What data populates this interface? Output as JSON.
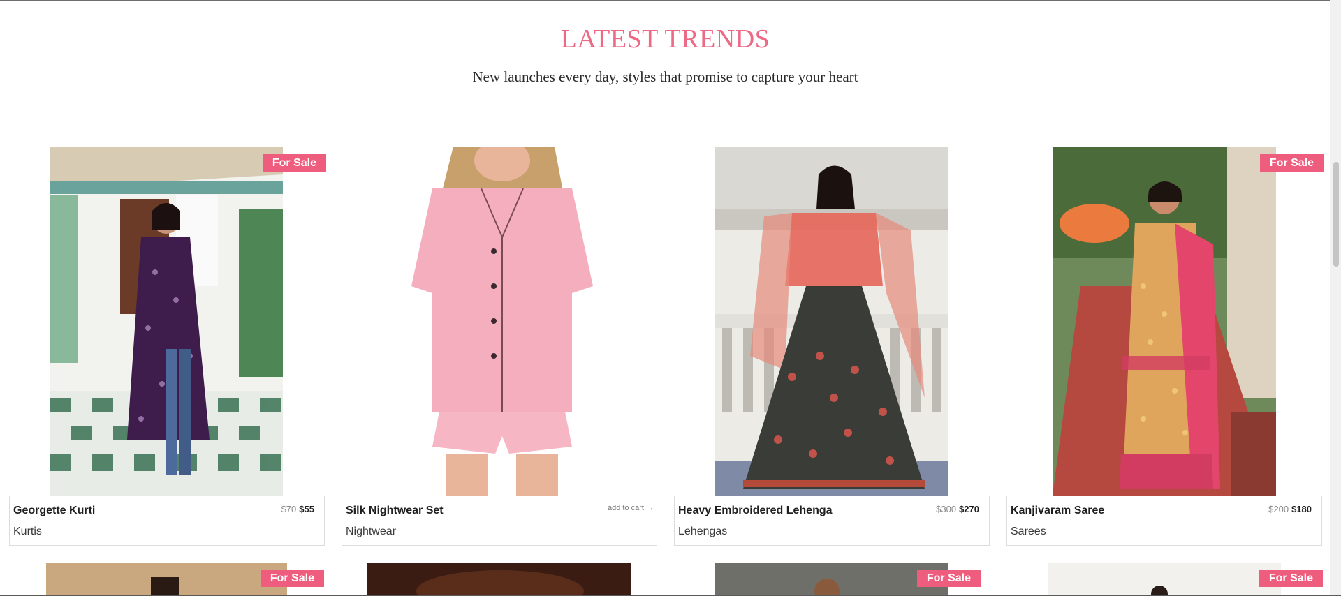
{
  "section": {
    "title": "LATEST TRENDS",
    "subtitle": "New launches every day, styles that promise to capture your heart"
  },
  "products": [
    {
      "name": "Georgette Kurti",
      "category": "Kurtis",
      "old_price": "$70",
      "price": "$55",
      "badge": "For Sale"
    },
    {
      "name": "Silk Nightwear Set",
      "category": "Nightwear",
      "action": "add to cart →"
    },
    {
      "name": "Heavy Embroidered Lehenga",
      "category": "Lehengas",
      "old_price": "$300",
      "price": "$270"
    },
    {
      "name": "Kanjivaram Saree",
      "category": "Sarees",
      "old_price": "$200",
      "price": "$180",
      "badge": "For Sale"
    }
  ],
  "next_row_badges": [
    "For Sale",
    "For Sale",
    "For Sale"
  ],
  "colors": {
    "accent": "#ee5d7d",
    "title": "#ec6a86"
  }
}
